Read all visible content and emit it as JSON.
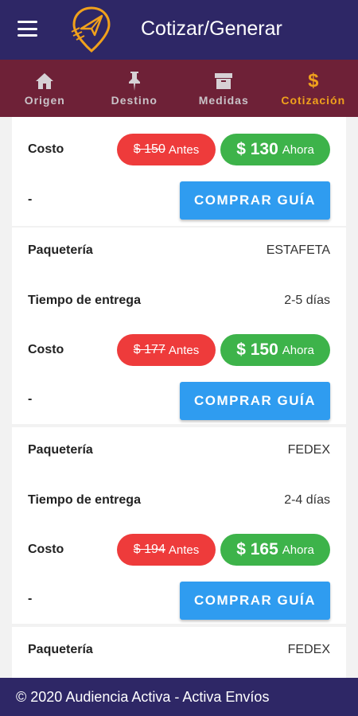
{
  "header": {
    "title": "Cotizar/Generar"
  },
  "tabs": [
    {
      "label": "Origen",
      "icon": "home-icon"
    },
    {
      "label": "Destino",
      "icon": "pin-icon"
    },
    {
      "label": "Medidas",
      "icon": "box-icon"
    },
    {
      "label": "Cotización",
      "icon": "dollar-icon",
      "symbol": "$",
      "active": true
    }
  ],
  "labels": {
    "paqueteria": "Paquetería",
    "tiempo": "Tiempo de entrega",
    "costo": "Costo",
    "dash": "-",
    "antes": "Antes",
    "ahora": "Ahora",
    "comprar": "COMPRAR GUÍA"
  },
  "quotes": [
    {
      "old_price": "$ 150",
      "new_price": "$ 130"
    },
    {
      "carrier": "ESTAFETA",
      "delivery": "2-5 días",
      "old_price": "$ 177",
      "new_price": "$ 150"
    },
    {
      "carrier": "FEDEX",
      "delivery": "2-4 días",
      "old_price": "$ 194",
      "new_price": "$ 165"
    },
    {
      "carrier": "FEDEX"
    }
  ],
  "footer": {
    "text": "© 2020 Audiencia Activa - Activa Envíos"
  },
  "colors": {
    "primary": "#2e2766",
    "tabbar": "#6e2137",
    "accent": "#f0a11c",
    "old": "#ee3b3b",
    "new": "#3db34a",
    "button": "#2f9cf0"
  }
}
